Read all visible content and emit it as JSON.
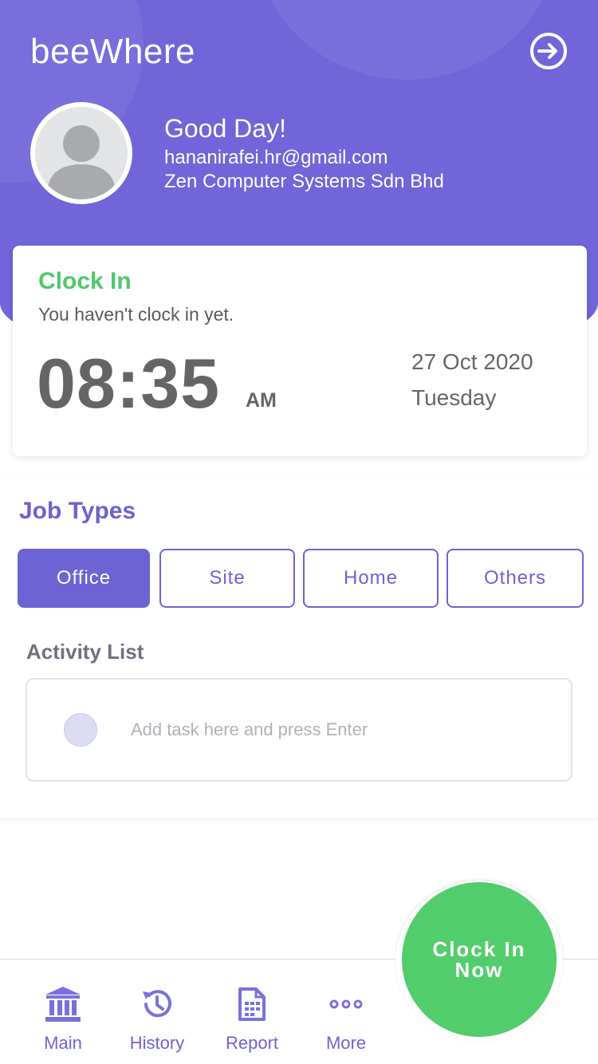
{
  "header": {
    "app_title": "beeWhere",
    "greeting": "Good Day!",
    "email": "hananirafei.hr@gmail.com",
    "company": "Zen Computer Systems Sdn Bhd",
    "logout_icon": "logout-icon",
    "avatar_icon": "user-avatar-placeholder",
    "color": "#7165d9"
  },
  "clock_card": {
    "label": "Clock In",
    "status": "You haven't clock in yet.",
    "time": "08:35",
    "ampm": "AM",
    "date": "27 Oct 2020",
    "day": "Tuesday",
    "label_color": "#4fc86b"
  },
  "job_types": {
    "title": "Job Types",
    "options": [
      "Office",
      "Site",
      "Home",
      "Others"
    ],
    "selected": "Office",
    "accent": "#6d63d4"
  },
  "activity": {
    "title": "Activity List",
    "placeholder": "Add task here and press Enter"
  },
  "clock_button": {
    "label": "Clock In Now",
    "color": "#52cd6b"
  },
  "nav": {
    "items": [
      {
        "label": "Main",
        "icon": "bank-icon"
      },
      {
        "label": "History",
        "icon": "history-icon"
      },
      {
        "label": "Report",
        "icon": "report-icon"
      },
      {
        "label": "More",
        "icon": "more-icon"
      }
    ]
  }
}
